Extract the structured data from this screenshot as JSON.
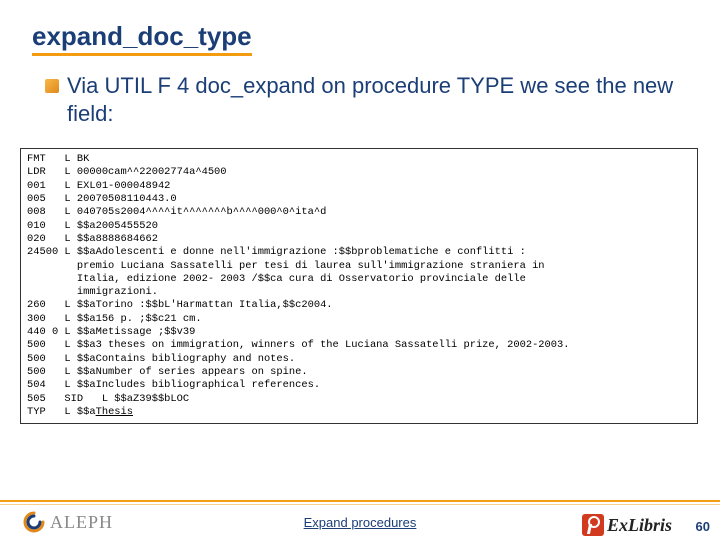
{
  "title": "expand_doc_type",
  "bullet": "Via UTIL F 4 doc_expand on procedure TYPE we see the new field:",
  "code": {
    "lines": [
      "FMT   L BK",
      "LDR   L 00000cam^^22002774a^4500",
      "001   L EXL01-000048942",
      "005   L 20070508110443.0",
      "008   L 040705s2004^^^^it^^^^^^^b^^^^000^0^ita^d",
      "010   L $$a2005455520",
      "020   L $$a8888684662",
      "24500 L $$aAdolescenti e donne nell'immigrazione :$$bproblematiche e conflitti :",
      "        premio Luciana Sassatelli per tesi di laurea sull'immigrazione straniera in",
      "        Italia, edizione 2002- 2003 /$$ca cura di Osservatorio provinciale delle",
      "        immigrazioni.",
      "260   L $$aTorino :$$bL'Harmattan Italia,$$c2004.",
      "300   L $$a156 p. ;$$c21 cm.",
      "440 0 L $$aMetissage ;$$v39",
      "500   L $$a3 theses on immigration, winners of the Luciana Sassatelli prize, 2002-2003.",
      "500   L $$aContains bibliography and notes.",
      "500   L $$aNumber of series appears on spine.",
      "504   L $$aIncludes bibliographical references.",
      "505   SID   L $$aZ39$$bLOC"
    ],
    "last_line_prefix": "TYP   L $$a",
    "last_line_underlined": "Thesis"
  },
  "footer": {
    "center_link": "Expand procedures",
    "aleph": "ALEPH",
    "exlibris": "ExLibris",
    "page": "60"
  }
}
